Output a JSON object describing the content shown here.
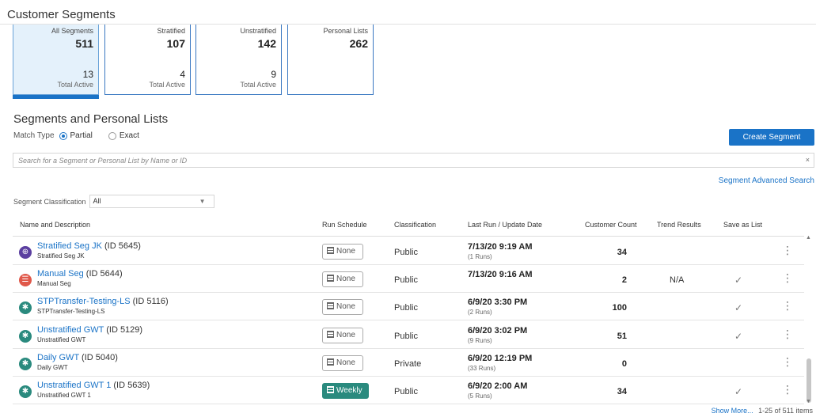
{
  "page_title": "Customer Segments",
  "tiles": [
    {
      "label": "All Segments",
      "count": "511",
      "active": "13",
      "active_label": "Total Active"
    },
    {
      "label": "Stratified",
      "count": "107",
      "active": "4",
      "active_label": "Total Active"
    },
    {
      "label": "Unstratified",
      "count": "142",
      "active": "9",
      "active_label": "Total Active"
    },
    {
      "label": "Personal Lists",
      "count": "262",
      "active": "",
      "active_label": ""
    }
  ],
  "section_title": "Segments and Personal Lists",
  "match_type": {
    "label": "Match Type",
    "partial": "Partial",
    "exact": "Exact",
    "selected": "Partial"
  },
  "create_button": "Create Segment",
  "search": {
    "placeholder": "Search for a Segment or Personal List by Name or ID",
    "clear": "×"
  },
  "advanced_search": "Segment Advanced Search",
  "classification_filter": {
    "label": "Segment Classification",
    "value": "All"
  },
  "columns": {
    "name": "Name and Description",
    "schedule": "Run Schedule",
    "classification": "Classification",
    "last_run": "Last Run / Update Date",
    "count": "Customer Count",
    "trend": "Trend Results",
    "save": "Save as List"
  },
  "rows": [
    {
      "name": "Stratified Seg JK",
      "id": "(ID 5645)",
      "desc": "Stratified Seg JK",
      "schedule": "None",
      "classification": "Public",
      "date": "7/13/20 9:19 AM",
      "runs": "(1 Runs)",
      "count": "34",
      "trend": "",
      "saved": "",
      "icon": "stratified-icon",
      "color": "#5b3fa0"
    },
    {
      "name": "Manual Seg",
      "id": "(ID 5644)",
      "desc": "Manual Seg",
      "schedule": "None",
      "classification": "Public",
      "date": "7/13/20 9:16 AM",
      "runs": "",
      "count": "2",
      "trend": "N/A",
      "saved": "✓",
      "icon": "manual-icon",
      "color": "#e0584a"
    },
    {
      "name": "STPTransfer-Testing-LS",
      "id": "(ID 5116)",
      "desc": "STPTransfer-Testing-LS",
      "schedule": "None",
      "classification": "Public",
      "date": "6/9/20 3:30 PM",
      "runs": "(2 Runs)",
      "count": "100",
      "trend": "",
      "saved": "✓",
      "icon": "unstratified-icon",
      "color": "#2a8a7e"
    },
    {
      "name": "Unstratified GWT",
      "id": "(ID 5129)",
      "desc": "Unstratified GWT",
      "schedule": "None",
      "classification": "Public",
      "date": "6/9/20 3:02 PM",
      "runs": "(9 Runs)",
      "count": "51",
      "trend": "",
      "saved": "✓",
      "icon": "unstratified-icon",
      "color": "#2a8a7e"
    },
    {
      "name": "Daily GWT",
      "id": "(ID 5040)",
      "desc": "Daily GWT",
      "schedule": "None",
      "classification": "Private",
      "date": "6/9/20 12:19 PM",
      "runs": "(33 Runs)",
      "count": "0",
      "trend": "",
      "saved": "",
      "icon": "unstratified-icon",
      "color": "#2a8a7e"
    },
    {
      "name": "Unstratified GWT 1",
      "id": "(ID 5639)",
      "desc": "Unstratified GWT 1",
      "schedule": "Weekly",
      "classification": "Public",
      "date": "6/9/20 2:00 AM",
      "runs": "(5 Runs)",
      "count": "34",
      "trend": "",
      "saved": "✓",
      "icon": "unstratified-icon",
      "color": "#2a8a7e"
    }
  ],
  "footer": {
    "show_more": "Show More...",
    "range": "1-25 of 511 items"
  }
}
